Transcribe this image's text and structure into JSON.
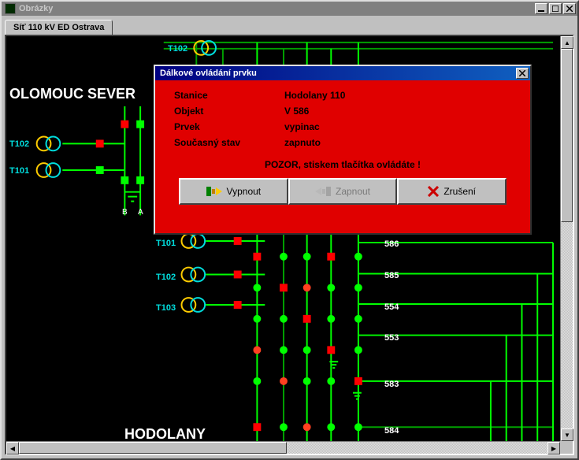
{
  "window": {
    "title": "Obrázky",
    "tab": "Síť 110 kV ED Ostrava"
  },
  "diagram": {
    "station_left": "OLOMOUC SEVER",
    "station_bottom": "HODOLANY",
    "trafo_labels": {
      "T102_top": "T102",
      "T102": "T102",
      "T101": "T101",
      "T101b": "T101",
      "T102b": "T102",
      "T103": "T103"
    },
    "bus_labels": {
      "B": "B",
      "A": "A"
    },
    "feeders": [
      "586",
      "585",
      "554",
      "553",
      "583",
      "584"
    ]
  },
  "dialog": {
    "title": "Dálkové ovládání prvku",
    "labels": {
      "stanice": "Stanice",
      "objekt": "Objekt",
      "prvek": "Prvek",
      "stav": "Současný stav"
    },
    "values": {
      "stanice": "Hodolany  110",
      "objekt": "V 586",
      "prvek": "vypinac",
      "stav": "zapnuto"
    },
    "warning": "POZOR, stiskem tlačítka ovládáte !",
    "buttons": {
      "off": "Vypnout",
      "on": "Zapnout",
      "cancel": "Zrušení"
    }
  }
}
